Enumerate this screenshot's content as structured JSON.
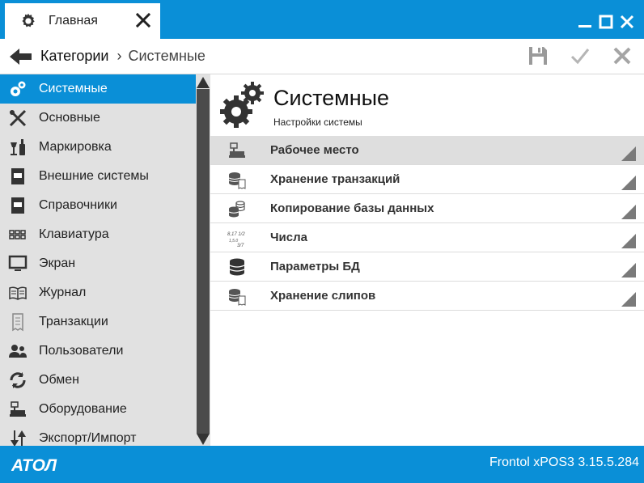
{
  "window": {
    "tab_label": "Главная",
    "colors": {
      "accent": "#0a8fd7",
      "sidebar_bg": "#e1e1e1",
      "scroll_thumb": "#4b4b4b",
      "selected_row": "#dedede"
    }
  },
  "breadcrumb": {
    "root": "Категории",
    "separator": "›",
    "current": "Системные"
  },
  "toolbar": {
    "icons": [
      "save-icon",
      "check-icon",
      "close-icon"
    ]
  },
  "sidebar": {
    "items": [
      {
        "label": "Системные",
        "icon": "gears-icon",
        "active": true
      },
      {
        "label": "Основные",
        "icon": "tools-icon"
      },
      {
        "label": "Маркировка",
        "icon": "bottle-glass-icon"
      },
      {
        "label": "Внешние системы",
        "icon": "book-icon"
      },
      {
        "label": "Справочники",
        "icon": "book-icon"
      },
      {
        "label": "Клавиатура",
        "icon": "keyboard-icon"
      },
      {
        "label": "Экран",
        "icon": "monitor-icon"
      },
      {
        "label": "Журнал",
        "icon": "open-book-icon"
      },
      {
        "label": "Транзакции",
        "icon": "receipt-icon"
      },
      {
        "label": "Пользователи",
        "icon": "users-icon"
      },
      {
        "label": "Обмен",
        "icon": "sync-icon"
      },
      {
        "label": "Оборудование",
        "icon": "cash-register-icon"
      },
      {
        "label": "Экспорт/Импорт",
        "icon": "arrows-updown-icon"
      }
    ]
  },
  "main": {
    "title": "Системные",
    "subtitle": "Настройки системы",
    "rows": [
      {
        "label": "Рабочее место",
        "icon": "cash-register-icon",
        "selected": true
      },
      {
        "label": "Хранение транзакций",
        "icon": "database-receipt-icon"
      },
      {
        "label": "Копирование базы данных",
        "icon": "database-copy-icon"
      },
      {
        "label": "Числа",
        "icon": "numbers-icon",
        "icon_text": "8,17 1/2 1,5.0 3/7"
      },
      {
        "label": "Параметры БД",
        "icon": "database-icon"
      },
      {
        "label": "Хранение слипов",
        "icon": "database-receipt-icon"
      }
    ]
  },
  "status": {
    "logo_text": "АТОЛ",
    "version": "Frontol xPOS3 3.15.5.284"
  }
}
